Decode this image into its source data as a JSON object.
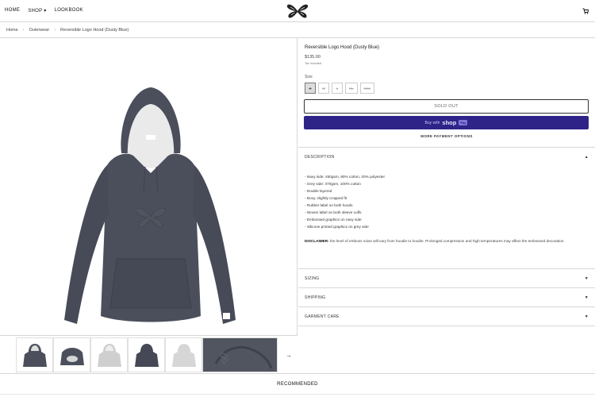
{
  "nav": {
    "links": [
      "HOME",
      "SHOP ▾",
      "LOOKBOOK"
    ]
  },
  "breadcrumb": [
    "Home",
    "Outerwear",
    "Reversible Logo Hood (Dusty Blue)"
  ],
  "product": {
    "title": "Reversible Logo Hood (Dusty Blue)",
    "price": "$135.00",
    "tax_note": "Tax included.",
    "size_label": "Size",
    "sizes": [
      "S",
      "M",
      "L",
      "XL",
      "XXL"
    ],
    "selected_size": "S",
    "sold_out_label": "SOLD OUT",
    "shop_pay": {
      "prefix": "Buy with",
      "brand": "shop",
      "badge": "Pay"
    },
    "more_payment_label": "MORE PAYMENT OPTIONS"
  },
  "accordion": {
    "description_label": "DESCRIPTION",
    "sizing_label": "SIZING",
    "shipping_label": "SHIPPING",
    "care_label": "GARMENT CARE"
  },
  "description": {
    "bullets": [
      "- Navy side: 460gsm, 80% cotton, 20% polyester",
      "- Grey side: 370gsm, 100% cotton",
      "- Double layered",
      "- Boxy, slightly cropped fit",
      "- Rubber label on both hoods",
      "- Woven label on both sleeve cuffs",
      "- Embossed graphics on navy side",
      "- Silicone printed graphics on grey side"
    ],
    "disclaimer_label": "DISCLAIMER:",
    "disclaimer_text": "the level of emboss noise will vary from hoodie to hoodie. Prolonged compression and high temperatures may affect the embossed decoration."
  },
  "gallery": {
    "next_arrow": "→"
  },
  "recommended_label": "RECOMMENDED",
  "colors": {
    "hoodie_navy": "#4b4f5c",
    "hoodie_grey": "#c9c9c9",
    "shop_pay": "#2e2488"
  }
}
